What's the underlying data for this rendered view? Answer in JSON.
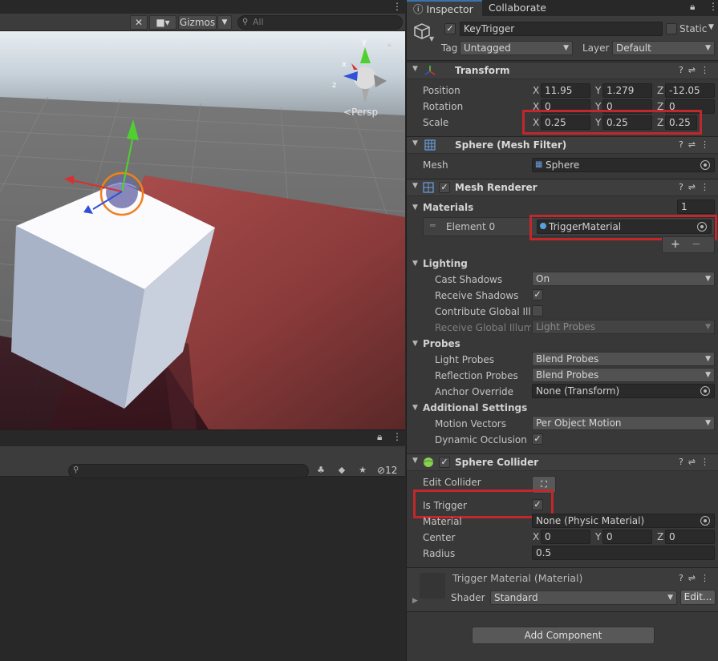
{
  "scene": {
    "gizmos_label": "Gizmos",
    "search_placeholder": "All",
    "persp_label": "Persp"
  },
  "hierarchy": {
    "visible_count": "12"
  },
  "inspector": {
    "tabs": [
      "Inspector",
      "Collaborate"
    ],
    "game_object": {
      "name": "KeyTrigger",
      "static_label": "Static",
      "tag_label": "Tag",
      "tag_value": "Untagged",
      "layer_label": "Layer",
      "layer_value": "Default"
    },
    "transform": {
      "title": "Transform",
      "position_label": "Position",
      "rotation_label": "Rotation",
      "scale_label": "Scale",
      "axis_labels": [
        "X",
        "Y",
        "Z"
      ],
      "position": [
        "11.95",
        "1.279",
        "-12.05"
      ],
      "rotation": [
        "0",
        "0",
        "0"
      ],
      "scale": [
        "0.25",
        "0.25",
        "0.25"
      ]
    },
    "mesh_filter": {
      "title": "Sphere (Mesh Filter)",
      "mesh_label": "Mesh",
      "mesh_value": "Sphere"
    },
    "mesh_renderer": {
      "title": "Mesh Renderer",
      "materials_label": "Materials",
      "materials_count": "1",
      "element_label": "Element 0",
      "element_value": "TriggerMaterial",
      "add_label": "+",
      "remove_label": "−",
      "lighting_label": "Lighting",
      "cast_shadows_label": "Cast Shadows",
      "cast_shadows_value": "On",
      "receive_shadows_label": "Receive Shadows",
      "contribute_gi_label": "Contribute Global Illumi",
      "receive_gi_label": "Receive Global Illumi",
      "receive_gi_value": "Light Probes",
      "probes_label": "Probes",
      "light_probes_label": "Light Probes",
      "light_probes_value": "Blend Probes",
      "reflection_probes_label": "Reflection Probes",
      "reflection_probes_value": "Blend Probes",
      "anchor_override_label": "Anchor Override",
      "anchor_override_value": "None (Transform)",
      "additional_label": "Additional Settings",
      "motion_vectors_label": "Motion Vectors",
      "motion_vectors_value": "Per Object Motion",
      "dynamic_occlusion_label": "Dynamic Occlusion"
    },
    "sphere_collider": {
      "title": "Sphere Collider",
      "edit_collider_label": "Edit Collider",
      "is_trigger_label": "Is Trigger",
      "material_label": "Material",
      "material_value": "None (Physic Material)",
      "center_label": "Center",
      "center": [
        "0",
        "0",
        "0"
      ],
      "radius_label": "Radius",
      "radius_value": "0.5"
    },
    "material": {
      "title": "Trigger Material (Material)",
      "shader_label": "Shader",
      "shader_value": "Standard",
      "edit_label": "Edit..."
    },
    "add_component_label": "Add Component"
  },
  "colors": {
    "highlight_red": "#c0282c",
    "floor_red": "#8c3a3a",
    "sky": "#c7d3dc",
    "selection_orange": "#f08020",
    "axis_x": "#d83030",
    "axis_y": "#50d030",
    "axis_z": "#3050d8"
  }
}
